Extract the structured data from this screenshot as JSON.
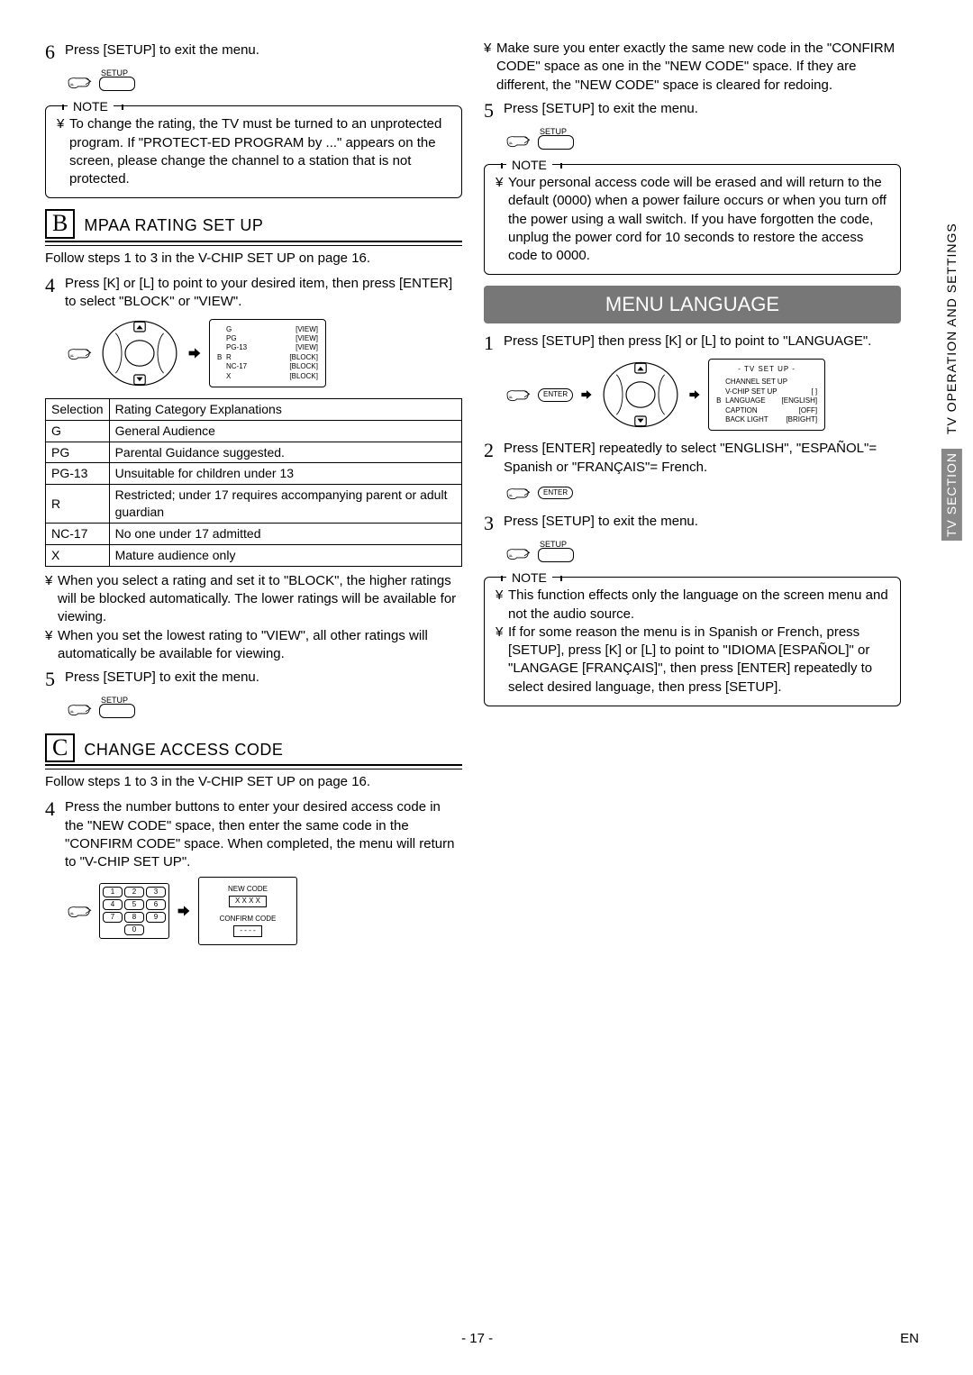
{
  "col1": {
    "step6": "Press [SETUP] to exit the menu.",
    "setup_label": "SETUP",
    "noteTitle": "NOTE",
    "note1": "To change the rating, the TV must be turned to an unprotected program. If \"PROTECT-ED PROGRAM by ...\" appears on the screen, please change the channel to a station that is not protected.",
    "sectionB_letter": "B",
    "sectionB_title": "MPAA RATING SET UP",
    "sectionB_intro": "Follow steps 1 to 3 in the V-CHIP SET UP on page 16.",
    "stepB4": "Press [K] or [L] to point to your desired item, then press [ENTER] to select \"BLOCK\" or \"VIEW\".",
    "screenB": {
      "rows": [
        {
          "s": "G",
          "v": "[VIEW]"
        },
        {
          "s": "PG",
          "v": "[VIEW]"
        },
        {
          "s": "PG-13",
          "v": "[VIEW]"
        },
        {
          "s": "R",
          "v": "[BLOCK]",
          "pre": "B"
        },
        {
          "s": "NC-17",
          "v": "[BLOCK]"
        },
        {
          "s": "X",
          "v": "[BLOCK]"
        }
      ]
    },
    "table_h1": "Selection",
    "table_h2": "Rating Category Explanations",
    "table_rows": [
      {
        "s": "G",
        "e": "General Audience"
      },
      {
        "s": "PG",
        "e": "Parental Guidance suggested."
      },
      {
        "s": "PG-13",
        "e": "Unsuitable for children under 13"
      },
      {
        "s": "R",
        "e": "Restricted; under 17 requires accompanying parent or adult guardian"
      },
      {
        "s": "NC-17",
        "e": "No one under 17 admitted"
      },
      {
        "s": "X",
        "e": "Mature audience only"
      }
    ],
    "bulletB1": "When you select a rating and set it to \"BLOCK\", the higher ratings will be blocked automatically. The lower ratings will be available for viewing.",
    "bulletB2": "When you set the lowest rating to \"VIEW\", all other ratings will automatically be available for viewing.",
    "stepB5": "Press [SETUP] to exit the menu.",
    "sectionC_letter": "C",
    "sectionC_title": "CHANGE ACCESS CODE",
    "sectionC_intro": "Follow steps 1 to 3 in the V-CHIP SET UP on page 16.",
    "stepC4": "Press the number buttons to enter your desired access code in the \"NEW CODE\" space, then enter the same code in the \"CONFIRM CODE\" space. When completed, the menu will return to \"V-CHIP SET UP\".",
    "keypad": [
      "1",
      "2",
      "3",
      "4",
      "5",
      "6",
      "7",
      "8",
      "9",
      "0"
    ],
    "confbox": {
      "l1": "NEW CODE",
      "v1": "X X X X",
      "l2": "CONFIRM CODE",
      "v2": "- - - -"
    }
  },
  "col2": {
    "bullet_top": "Make sure you enter exactly the same new code in the \"CONFIRM CODE\" space as one in the \"NEW CODE\" space. If they are different, the \"NEW CODE\" space is cleared for redoing.",
    "step5": "Press [SETUP] to exit the menu.",
    "setup_label": "SETUP",
    "noteTitle": "NOTE",
    "note1": "Your personal access code will be erased and will return to the default (0000) when a power failure occurs or when you turn off the power using a wall switch. If you have forgotten the code, unplug the power cord for 10 seconds to restore the access code to 0000.",
    "banner": "MENU LANGUAGE",
    "stepM1": "Press [SETUP] then press [K] or [L] to point to \"LANGUAGE\".",
    "enter_label": "ENTER",
    "screenM": {
      "hdr": "- TV SET UP -",
      "rows": [
        {
          "a": "",
          "b": "CHANNEL SET UP",
          "c": ""
        },
        {
          "a": "",
          "b": "V-CHIP SET UP",
          "c": "[         ]"
        },
        {
          "a": "B",
          "b": "LANGUAGE",
          "c": "[ENGLISH]"
        },
        {
          "a": "",
          "b": "CAPTION",
          "c": "[OFF]"
        },
        {
          "a": "",
          "b": "BACK LIGHT",
          "c": "[BRIGHT]"
        }
      ]
    },
    "stepM2": "Press [ENTER] repeatedly to select \"ENGLISH\", \"ESPAÑOL\"= Spanish or \"FRANÇAIS\"= French.",
    "stepM3": "Press [SETUP] to exit the menu.",
    "note2Title": "NOTE",
    "note2a": "This function effects only the language on the screen menu and not the audio source.",
    "note2b": "If for some reason the menu is in Spanish or French, press [SETUP], press [K] or [L] to point to \"IDIOMA [ESPAÑOL]\" or \"LANGAGE [FRANÇAIS]\", then press [ENTER] repeatedly to select desired language, then press [SETUP]."
  },
  "side": {
    "seg1": "TV SECTION",
    "seg2": "TV OPERATION AND SETTINGS"
  },
  "footer": {
    "page": "- 17 -",
    "lang": "EN"
  }
}
